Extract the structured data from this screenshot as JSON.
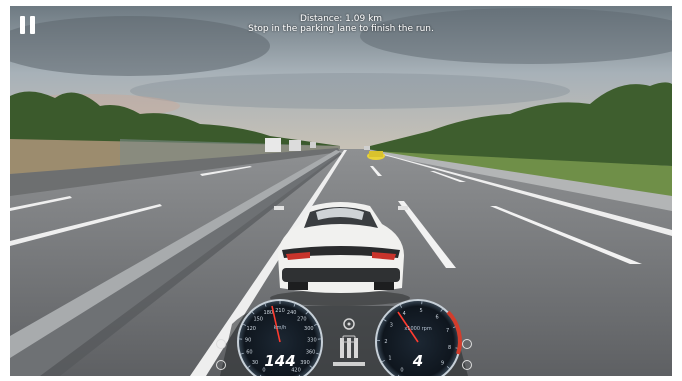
{
  "hud": {
    "distance_text": "Distance: 1.09 km",
    "instruction_text": "Stop in the parking lane to finish the run.",
    "pause_icon": "pause-icon"
  },
  "dashboard": {
    "speed_value": "144",
    "speed_unit": "km/h",
    "speed_ticks": [
      "0",
      "30",
      "60",
      "90",
      "120",
      "150",
      "180",
      "210",
      "240",
      "270",
      "300",
      "330",
      "360",
      "390",
      "420"
    ],
    "rpm_value": "4",
    "rpm_unit": "x1000 rpm",
    "rpm_ticks": [
      "0",
      "1",
      "2",
      "3",
      "4",
      "5",
      "6",
      "7",
      "8",
      "9"
    ],
    "needle_color": "#ff3b2f"
  },
  "colors": {
    "sky": "#9aa7b0",
    "road": "#7b7e80",
    "grass": "#6f8f48",
    "car": "#f2f2f0"
  }
}
